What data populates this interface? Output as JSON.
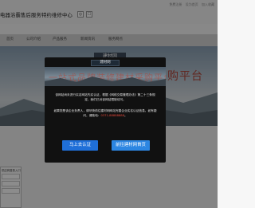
{
  "header": {
    "site_title": "电器浴霸售后服务特约维修中心",
    "badge_a": "◎",
    "badge_b": "☐",
    "links": [
      "免费注册",
      "设为首页",
      "加入收藏"
    ]
  },
  "nav": {
    "items": [
      "首页",
      "公司介绍",
      "产品服务",
      "新闻资讯",
      "服务网点"
    ]
  },
  "hero": {
    "logo_text": "建材网",
    "headline": "一站式品牌装修建材采购平台"
  },
  "login_card": {
    "title": "供应商登录入口"
  },
  "dialog": {
    "logo_text": "建材网",
    "hero_text": "一站式品牌装修建材采购平台",
    "paragraph1": "该网站尚未进行实名网站先实认证，根据《网络交易管理办法》第二十三条规定，我们已对该网站限制访问。",
    "paragraph2_prefix": "如果您是该企业负责人，请尽快前往建材网网站完善企业实名认证信息。如有疑问，请致电：",
    "phone": "0371-88888888",
    "paragraph2_suffix": "。",
    "primary_button": "马上去认证",
    "secondary_button": "前往建材网首页"
  }
}
